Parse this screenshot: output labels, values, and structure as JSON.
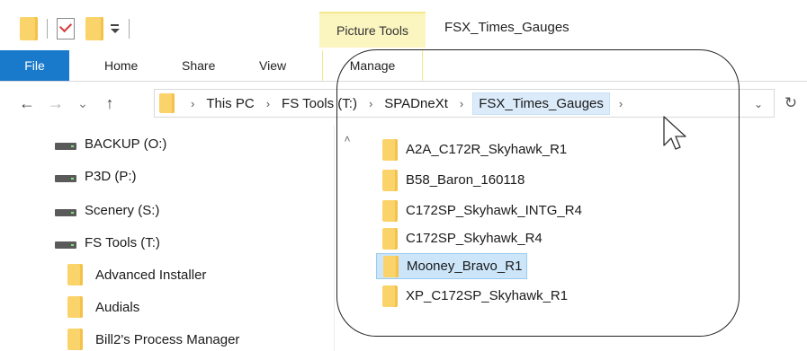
{
  "titlebar": {
    "contextual_tab_group": "Picture Tools",
    "window_title": "FSX_Times_Gauges"
  },
  "ribbon": {
    "tabs": [
      "File",
      "Home",
      "Share",
      "View",
      "Manage"
    ]
  },
  "navigation": {
    "back": "←",
    "forward": "→",
    "recent": "⌄",
    "up": "↑",
    "refresh": "↻",
    "dropdown": "⌄"
  },
  "address_bar": {
    "crumbs": [
      "This PC",
      "FS Tools (T:)",
      "SPADneXt",
      "FSX_Times_Gauges"
    ],
    "separator": "›"
  },
  "nav_pane": {
    "drives": [
      "BACKUP (O:)",
      "P3D (P:)",
      "Scenery (S:)",
      "FS Tools (T:)"
    ],
    "folders": [
      "Advanced Installer",
      "Audials",
      "Bill2's Process Manager"
    ]
  },
  "files": [
    {
      "name": "A2A_C172R_Skyhawk_R1",
      "selected": false
    },
    {
      "name": "B58_Baron_160118",
      "selected": false
    },
    {
      "name": "C172SP_Skyhawk_INTG_R4",
      "selected": false
    },
    {
      "name": "C172SP_Skyhawk_R4",
      "selected": false
    },
    {
      "name": "Mooney_Bravo_R1",
      "selected": true
    },
    {
      "name": "XP_C172SP_Skyhawk_R1",
      "selected": false
    }
  ],
  "colors": {
    "file_tab_bg": "#1979ca",
    "contextual_tab_bg": "#fbf5c0",
    "folder_yellow": "#fbd36b",
    "selection_bg": "#cce5f9",
    "breadcrumb_current_bg": "#dbebf9"
  },
  "icons": {
    "qat_folder": "folder-icon",
    "qat_properties": "properties-icon",
    "qat_new_folder": "new-folder-icon",
    "drive": "drive-icon",
    "folder": "folder-icon",
    "cursor": "mouse-cursor"
  }
}
